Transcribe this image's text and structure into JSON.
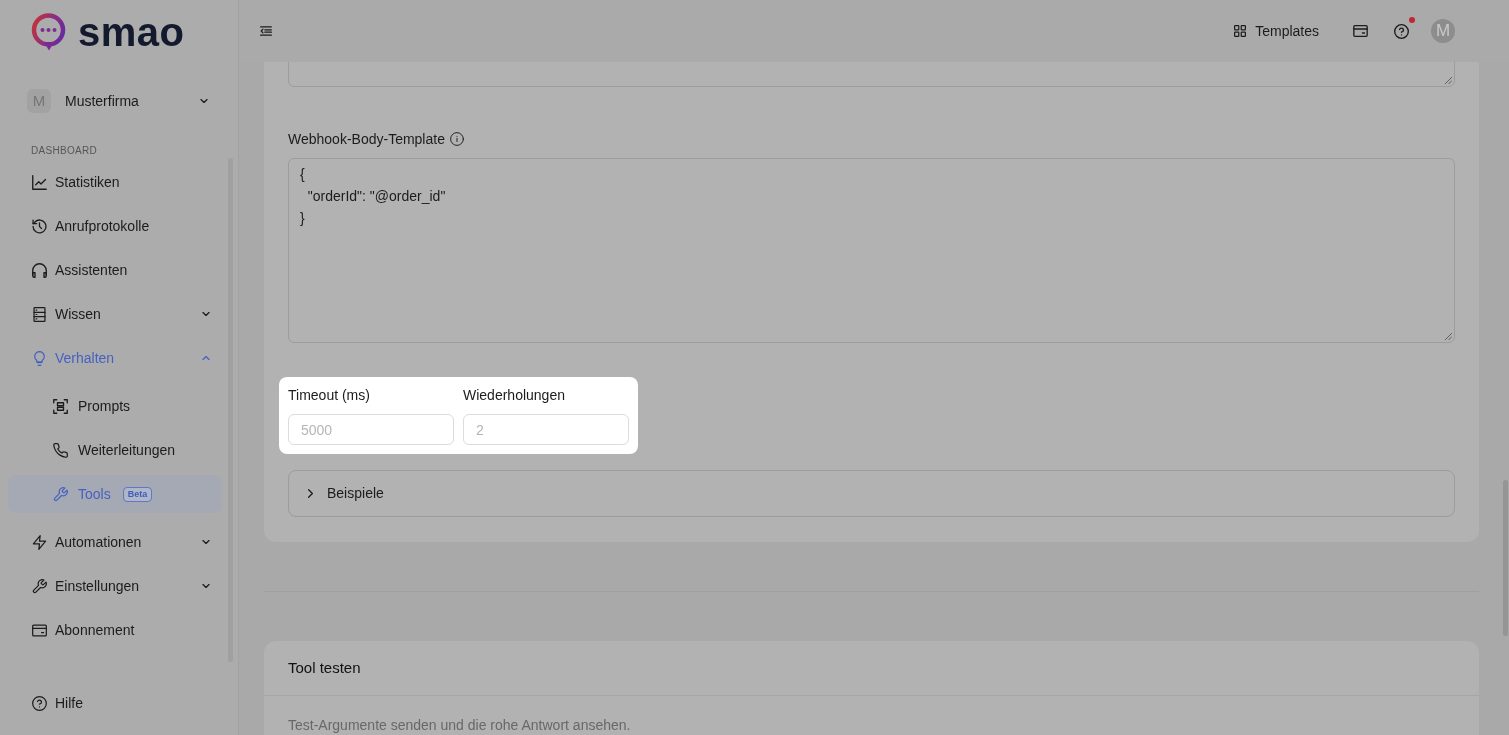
{
  "sidebar": {
    "logo": "smao",
    "workspace": {
      "initial": "M",
      "name": "Musterfirma"
    },
    "section_label": "DASHBOARD",
    "items": [
      {
        "label": "Statistiken",
        "selected": false
      },
      {
        "label": "Anrufprotokolle",
        "selected": false
      },
      {
        "label": "Assistenten",
        "selected": false
      },
      {
        "label": "Wissen",
        "selected": false,
        "expanded": false
      },
      {
        "label": "Verhalten",
        "selected": true,
        "expanded": true,
        "children": [
          {
            "label": "Prompts",
            "selected": false
          },
          {
            "label": "Weiterleitungen",
            "selected": false
          },
          {
            "label": "Tools",
            "selected": true,
            "badge": "Beta"
          }
        ]
      },
      {
        "label": "Automationen",
        "selected": false,
        "expanded": false
      },
      {
        "label": "Einstellungen",
        "selected": false,
        "expanded": false
      },
      {
        "label": "Abonnement",
        "selected": false
      }
    ],
    "footer_items": [
      {
        "label": "Hilfe"
      }
    ]
  },
  "header": {
    "templates_button": "Templates",
    "help_notification": true,
    "avatar_initial": "M"
  },
  "form": {
    "fields": [
      {
        "kind": "textarea"
      },
      {
        "kind": "textarea",
        "label": "Webhook-Body-Template",
        "info": true,
        "value": "{\n  \"orderId\": \"@order_id\"\n}"
      },
      {
        "kind": "input_pair",
        "spotlight": true,
        "inputs": [
          {
            "label": "Timeout (ms)",
            "placeholder": "5000"
          },
          {
            "label": "Wiederholungen",
            "placeholder": "2"
          }
        ]
      },
      {
        "kind": "collapsible",
        "label": "Beispiele",
        "expanded": false
      }
    ]
  },
  "test_panel": {
    "title": "Tool testen",
    "description": "Test-Argumente senden und die rohe Antwort ansehen."
  }
}
